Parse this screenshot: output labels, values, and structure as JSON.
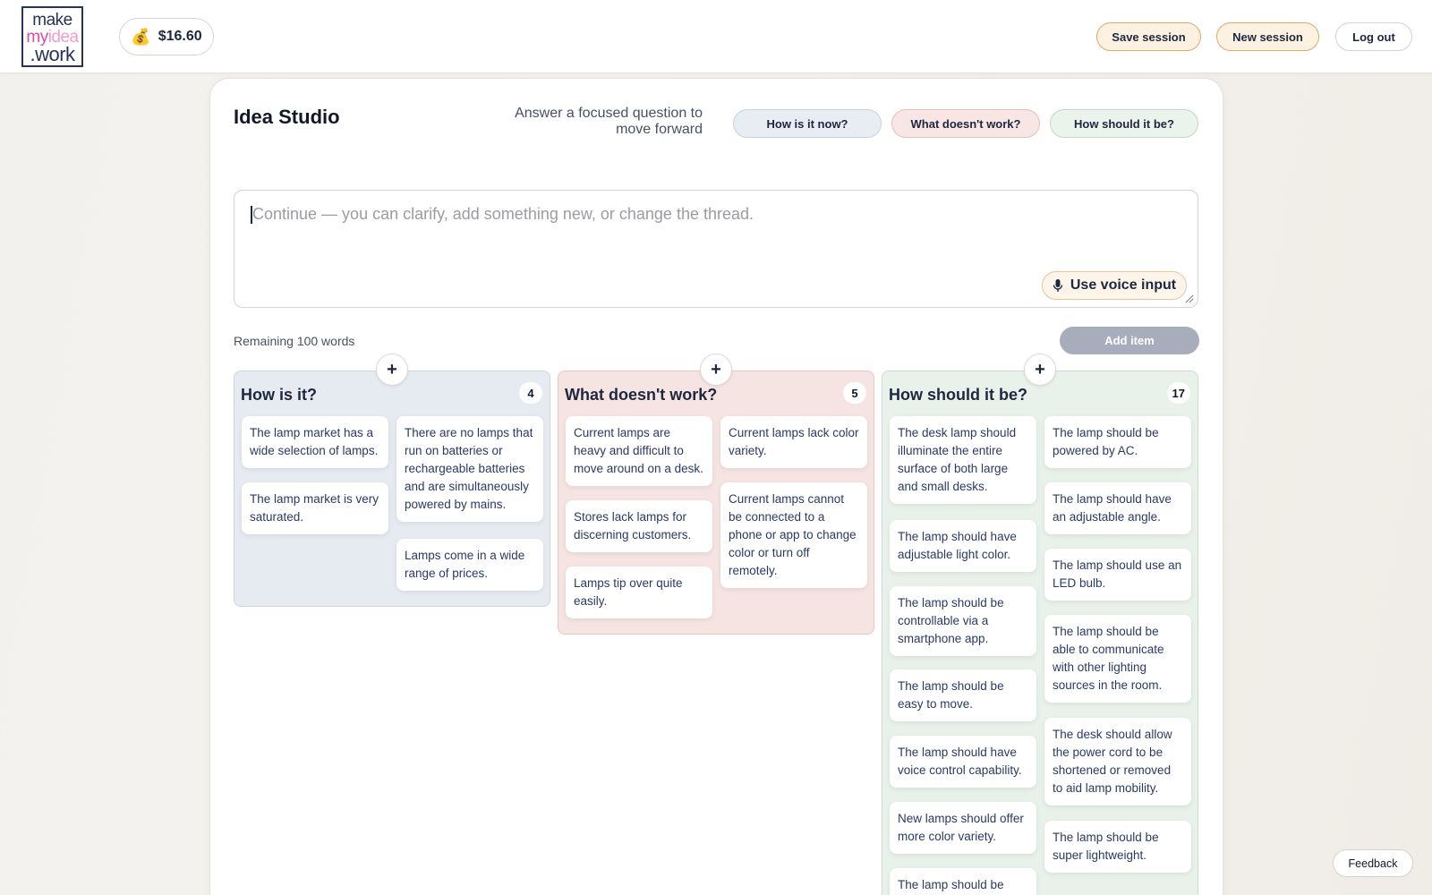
{
  "header": {
    "logo": {
      "line1": "make",
      "line2a": "my",
      "line2b": "idea",
      "line3": ".work"
    },
    "balance": "$16.60",
    "balance_icon": "money-bag-icon",
    "save_label": "Save session",
    "new_label": "New session",
    "logout_label": "Log out"
  },
  "studio": {
    "title": "Idea Studio",
    "prompt": "Answer a focused question to move forward",
    "questions": [
      "How is it now?",
      "What doesn't work?",
      "How should it be?"
    ],
    "input_placeholder": "Continue — you can clarify, add something new, or change the thread.",
    "voice_label": "Use voice input",
    "remaining": "Remaining 100 words",
    "add_item_label": "Add item"
  },
  "columns": [
    {
      "title": "How is it?",
      "count": "4",
      "notes": [
        "The lamp market has a wide selection of lamps.",
        "The lamp market is very saturated.",
        "There are no lamps that run on batteries or rechargeable batteries and are simultaneously powered by mains.",
        "Lamps come in a wide range of prices."
      ]
    },
    {
      "title": "What doesn't work?",
      "count": "5",
      "notes": [
        "Current lamps are heavy and difficult to move around on a desk.",
        "Stores lack lamps for discerning customers.",
        "Lamps tip over quite easily.",
        "Current lamps lack color variety.",
        "Current lamps cannot be connected to a phone or app to change color or turn off remotely."
      ]
    },
    {
      "title": "How should it be?",
      "count": "17",
      "notes": [
        "The desk lamp should illuminate the entire surface of both large and small desks.",
        "The lamp should have adjustable light color.",
        "The lamp should be controllable via a smartphone app.",
        "The lamp should be easy to move.",
        "The lamp should have voice control capability.",
        "New lamps should offer more color variety.",
        "The lamp should be",
        "The lamp should be powered by AC.",
        "The lamp should have an adjustable angle.",
        "The lamp should use an LED bulb.",
        "The lamp should be able to communicate with other lighting sources in the room.",
        "The desk should allow the power cord to be shortened or removed to aid lamp mobility.",
        "The lamp should be super lightweight."
      ]
    }
  ],
  "feedback_label": "Feedback",
  "colors": {
    "accent_orange_border": "#e7a66a",
    "now_bg": "#e6eaf1",
    "doesnt_bg": "#f6e4e2",
    "should_bg": "#e8f1ea",
    "text_navy": "#1e2740"
  }
}
